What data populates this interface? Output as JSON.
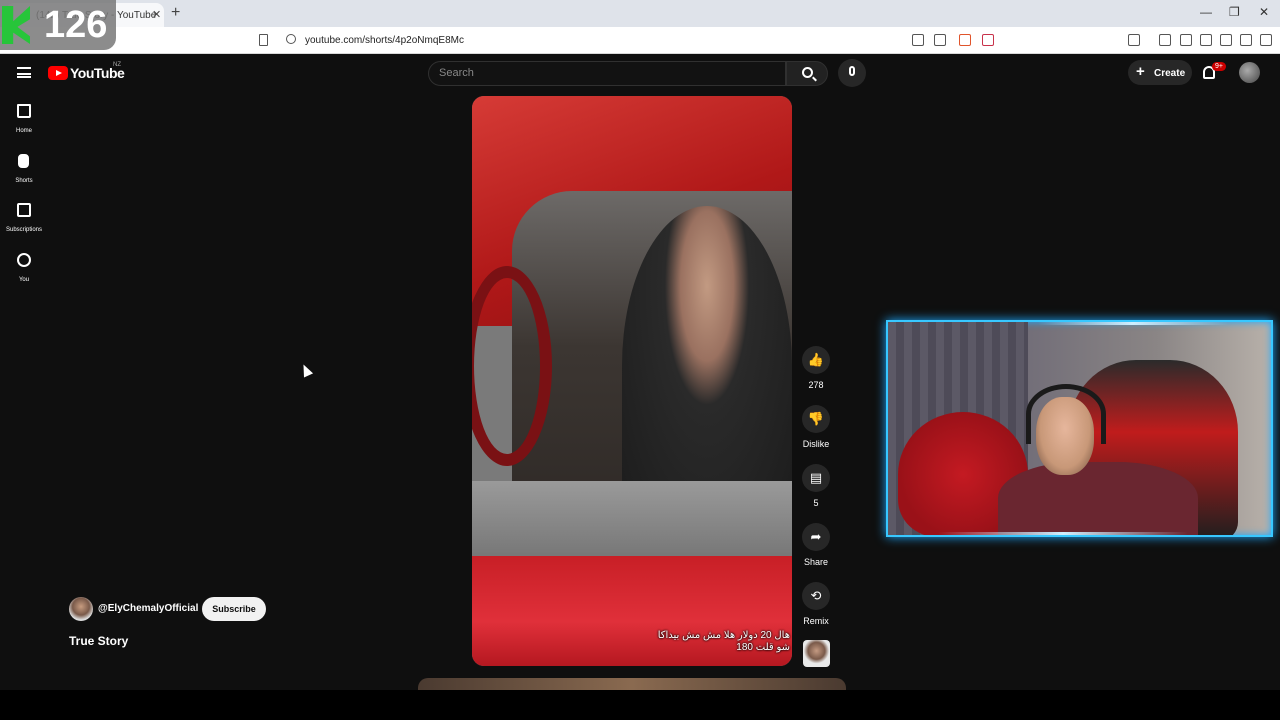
{
  "browser": {
    "tab_title": "(142) True Story - YouTube",
    "url": "youtube.com/shorts/4p2oNmqE8Mc"
  },
  "overlay": {
    "counter": "126"
  },
  "header": {
    "logo_text": "YouTube",
    "region": "NZ",
    "search_placeholder": "Search",
    "create_label": "Create",
    "notification_badge": "9+"
  },
  "sidebar": {
    "items": [
      {
        "label": "Home",
        "icon": "home-icon"
      },
      {
        "label": "Shorts",
        "icon": "shorts-icon"
      },
      {
        "label": "Subscriptions",
        "icon": "subscriptions-icon"
      },
      {
        "label": "You",
        "icon": "you-icon"
      }
    ]
  },
  "short": {
    "caption_line1": "هال 20 دولار هلا مش مش بيداكا",
    "caption_line2": "شو قلت 180",
    "channel_handle": "@ElyChemalyOfficial",
    "subscribe_label": "Subscribe",
    "title": "True Story"
  },
  "actions": {
    "like_count": "278",
    "dislike_label": "Dislike",
    "comment_count": "5",
    "share_label": "Share",
    "remix_label": "Remix"
  },
  "colors": {
    "background": "#0f0f0f",
    "brand_red": "#ff0000",
    "webcam_glow": "#38c8ff"
  }
}
